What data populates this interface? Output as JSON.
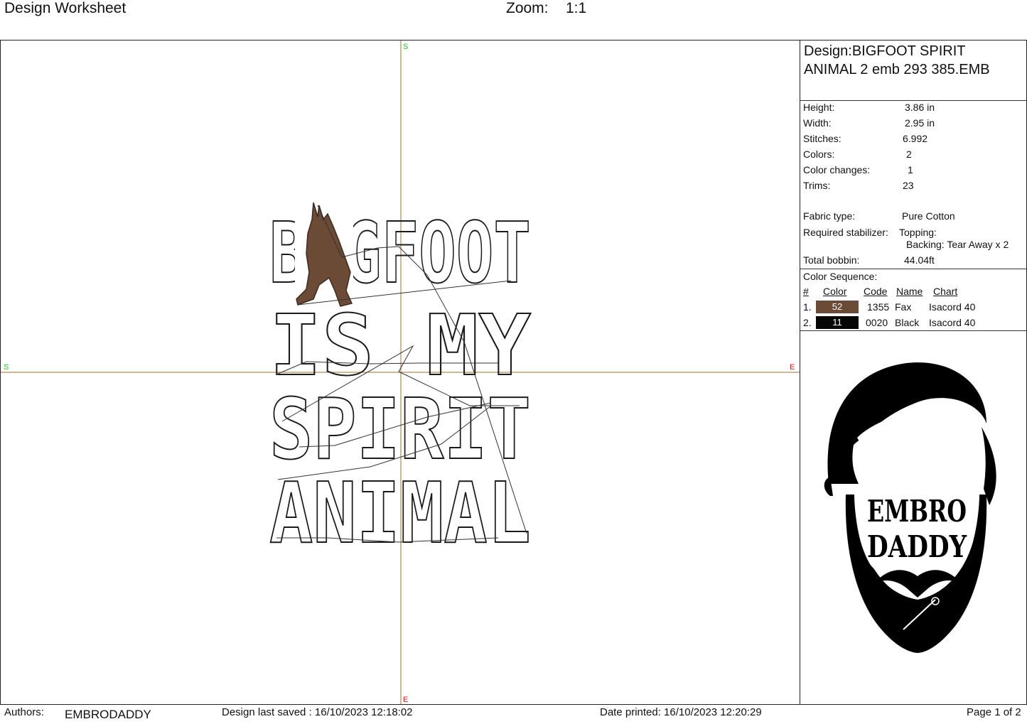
{
  "header": {
    "title": "Design Worksheet",
    "zoom_label": "Zoom:",
    "zoom_value": "1:1"
  },
  "canvas": {
    "marker_start": "S",
    "marker_end": "E",
    "design_lines": [
      "BIGFOOT",
      "IS MY",
      "SPIRIT",
      "ANIMAL"
    ],
    "stitch_colors": {
      "brown": "#6b4a36",
      "black": "#1a1a1a",
      "axis": "#a0702a"
    }
  },
  "info": {
    "design_name": "Design:BIGFOOT SPIRIT ANIMAL 2 emb 293 385.EMB",
    "stats": [
      {
        "label": "Height:",
        "value": "3.86 in"
      },
      {
        "label": "Width:",
        "value": "2.95 in"
      },
      {
        "label": "Stitches:",
        "value": "6.992"
      },
      {
        "label": "Colors:",
        "value": "2"
      },
      {
        "label": "Color changes:",
        "value": "1"
      },
      {
        "label": "Trims:",
        "value": "23"
      }
    ],
    "fabric_label": "Fabric type:",
    "fabric_value": "Pure Cotton",
    "stabilizer_label": "Required stabilizer:",
    "stabilizer_topping": "Topping:",
    "stabilizer_backing": "Backing: Tear Away x 2",
    "bobbin_label": "Total bobbin:",
    "bobbin_value": "44.04ft",
    "color_sequence_label": "Color Sequence:",
    "table_headers": [
      "#",
      "Color",
      "Code",
      "Name",
      "Chart"
    ],
    "colors": [
      {
        "num": "1.",
        "swatch": "52",
        "hex": "#6b4a36",
        "code": "1355",
        "name": "Fax",
        "chart": "Isacord 40"
      },
      {
        "num": "2.",
        "swatch": "11",
        "hex": "#050505",
        "code": "0020",
        "name": "Black",
        "chart": "Isacord 40"
      }
    ],
    "logo_line1": "EMBRO",
    "logo_line2": "DADDY"
  },
  "footer": {
    "authors_label": "Authors:",
    "authors_value": "EMBRODADDY",
    "saved": "Design last saved : 16/10/2023 12:18:02",
    "printed": "Date printed: 16/10/2023 12:20:29",
    "page": "Page 1 of 2"
  }
}
